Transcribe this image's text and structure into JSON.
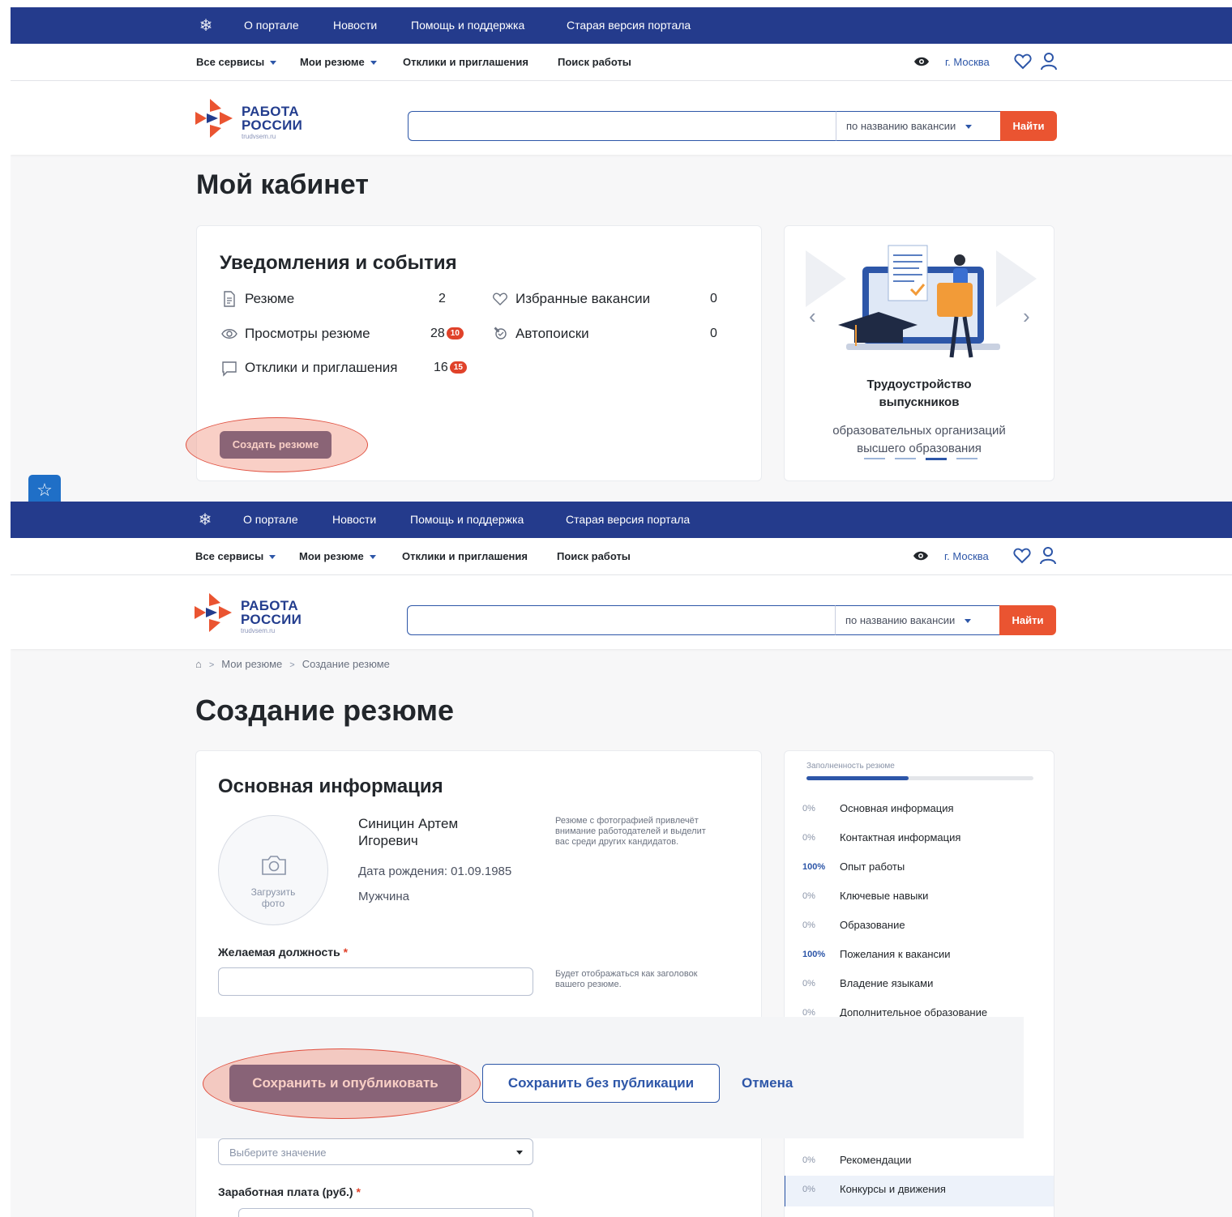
{
  "topbar": {
    "links": [
      "О портале",
      "Новости",
      "Помощь и поддержка",
      "Старая версия портала"
    ]
  },
  "navbar": {
    "all_services": "Все сервисы",
    "my_resumes": "Мои резюме",
    "responses": "Отклики и приглашения",
    "job_search": "Поиск работы",
    "city": "г. Москва"
  },
  "logo": {
    "line1": "РАБОТА",
    "line2": "РОССИИ",
    "site": "trudvsem.ru"
  },
  "search": {
    "value": "",
    "mode": "по названию вакансии",
    "button": "Найти"
  },
  "cabinet": {
    "title": "Мой кабинет",
    "events_title": "Уведомления и события",
    "items": {
      "resume": {
        "label": "Резюме",
        "count": "2"
      },
      "views": {
        "label": "Просмотры резюме",
        "count": "28",
        "badge": "10"
      },
      "responses": {
        "label": "Отклики и приглашения",
        "count": "16",
        "badge": "15"
      },
      "favorites": {
        "label": "Избранные вакансии",
        "count": "0"
      },
      "autosearch": {
        "label": "Автопоиски",
        "count": "0"
      }
    },
    "create_button": "Создать резюме",
    "promo": {
      "title_line1": "Трудоустройство",
      "title_line2": "выпускников",
      "text_line1": "образовательных организаций",
      "text_line2": "высшего образования",
      "active_slide": 3,
      "slide_count": 4
    }
  },
  "breadcrumbs": [
    "Мои резюме",
    "Создание резюме"
  ],
  "create": {
    "title": "Создание резюме",
    "section_title": "Основная информация",
    "photo_label_line1": "Загрузить",
    "photo_label_line2": "фото",
    "name_line1": "Синицин Артем",
    "name_line2": "Игоревич",
    "birth": "Дата рождения: 01.09.1985",
    "gender": "Мужчина",
    "photo_hint_line1": "Резюме с фотографией привлечёт",
    "photo_hint_line2": "внимание работодателей и выделит",
    "photo_hint_line3": "вас среди других кандидатов.",
    "position_label": "Желаемая должность",
    "position_value": "",
    "position_hint_line1": "Будет отображаться как заголовок",
    "position_hint_line2": "вашего резюме.",
    "select_placeholder": "Выберите значение",
    "salary_label": "Заработная плата (руб.)"
  },
  "progress": {
    "title": "Заполненность резюме",
    "fill_fraction": 0.45,
    "rows": [
      {
        "pct": "0%",
        "label": "Основная информация"
      },
      {
        "pct": "0%",
        "label": "Контактная информация"
      },
      {
        "pct": "100%",
        "label": "Опыт работы"
      },
      {
        "pct": "0%",
        "label": "Ключевые навыки"
      },
      {
        "pct": "0%",
        "label": "Образование"
      },
      {
        "pct": "100%",
        "label": "Пожелания к вакансии"
      },
      {
        "pct": "0%",
        "label": "Владение языками"
      },
      {
        "pct": "0%",
        "label": "Дополнительное образование"
      },
      {
        "pct": "0%",
        "label": "Рекомендации"
      },
      {
        "pct": "0%",
        "label": "Конкурсы и движения"
      }
    ]
  },
  "actions": {
    "publish": "Сохранить и опубликовать",
    "save_draft": "Сохранить без публикации",
    "cancel": "Отмена"
  },
  "colors": {
    "topbar": "#243b8c",
    "accent": "#2d56a8",
    "find_button": "#ea5431",
    "primary_button": "#404875",
    "badge": "#e0422a"
  }
}
